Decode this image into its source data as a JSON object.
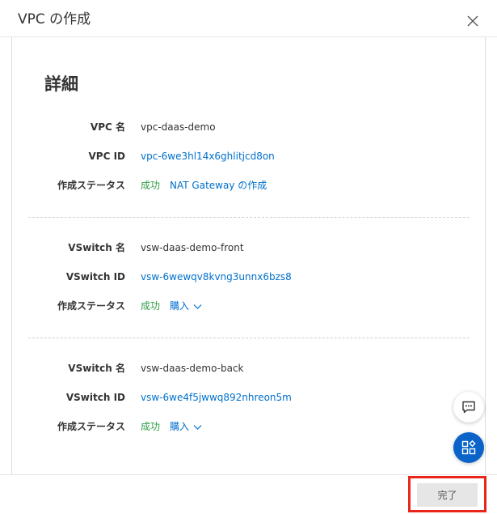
{
  "dialog": {
    "title": "VPC の作成"
  },
  "details": {
    "title": "詳細",
    "vpc": {
      "name_label": "VPC 名",
      "name": "vpc-daas-demo",
      "id_label": "VPC ID",
      "id": "vpc-6we3hl14x6ghlitjcd8on",
      "status_label": "作成ステータス",
      "status": "成功",
      "action": "NAT Gateway の作成"
    },
    "vswitch_front": {
      "name_label": "VSwitch 名",
      "name": "vsw-daas-demo-front",
      "id_label": "VSwitch ID",
      "id": "vsw-6wewqv8kvng3unnx6bzs8",
      "status_label": "作成ステータス",
      "status": "成功",
      "action": "購入"
    },
    "vswitch_back": {
      "name_label": "VSwitch 名",
      "name": "vsw-daas-demo-back",
      "id_label": "VSwitch ID",
      "id": "vsw-6we4f5jwwq892nhreon5m",
      "status_label": "作成ステータス",
      "status": "成功",
      "action": "購入"
    }
  },
  "footer": {
    "done_label": "完了"
  },
  "colors": {
    "link": "#0070cc",
    "success": "#2e9d46",
    "highlight": "#e8261a",
    "fab_blue": "#0a63c9"
  },
  "icons": {
    "close": "close-icon",
    "chat": "chat-icon",
    "apps": "apps-icon",
    "chevron": "chevron-down-icon"
  }
}
